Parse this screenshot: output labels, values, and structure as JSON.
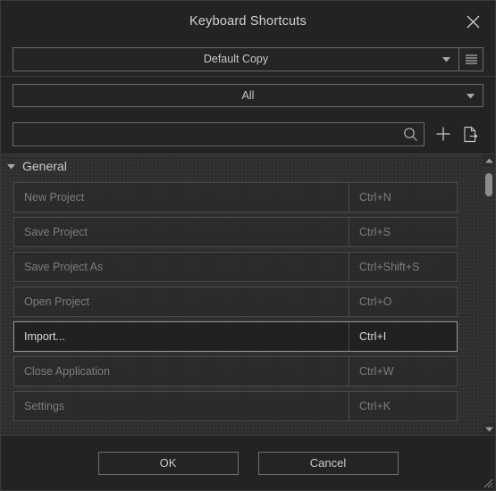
{
  "dialog": {
    "title": "Keyboard Shortcuts",
    "close_icon": "close-icon"
  },
  "profile": {
    "selected": "Default Copy",
    "caret_icon": "chevron-down-icon",
    "menu_icon": "hamburger-menu-icon"
  },
  "filter": {
    "selected": "All",
    "caret_icon": "chevron-down-icon"
  },
  "search": {
    "value": "",
    "placeholder": "",
    "search_icon": "search-icon",
    "add_icon": "plus-icon",
    "export_icon": "export-document-icon"
  },
  "list": {
    "group": {
      "label": "General",
      "expanded": true,
      "collapse_icon": "triangle-down-icon"
    },
    "rows": [
      {
        "name": "New Project",
        "keys": "Ctrl+N",
        "selected": false
      },
      {
        "name": "Save Project",
        "keys": "Ctrl+S",
        "selected": false
      },
      {
        "name": "Save Project As",
        "keys": "Ctrl+Shift+S",
        "selected": false
      },
      {
        "name": "Open Project",
        "keys": "Ctrl+O",
        "selected": false
      },
      {
        "name": "Import...",
        "keys": "Ctrl+I",
        "selected": true
      },
      {
        "name": "Close Application",
        "keys": "Ctrl+W",
        "selected": false
      },
      {
        "name": "Settings",
        "keys": "Ctrl+K",
        "selected": false
      }
    ],
    "scrollbar": {
      "up_icon": "scroll-up-arrow-icon",
      "down_icon": "scroll-down-arrow-icon"
    }
  },
  "footer": {
    "ok_label": "OK",
    "cancel_label": "Cancel",
    "grip_icon": "resize-grip-icon"
  },
  "colors": {
    "dialog_bg": "#232323",
    "list_bg": "#2e2e2e",
    "border": "#6a6a6a",
    "text": "#c8c8c8",
    "muted_text": "#7d7d7d"
  }
}
